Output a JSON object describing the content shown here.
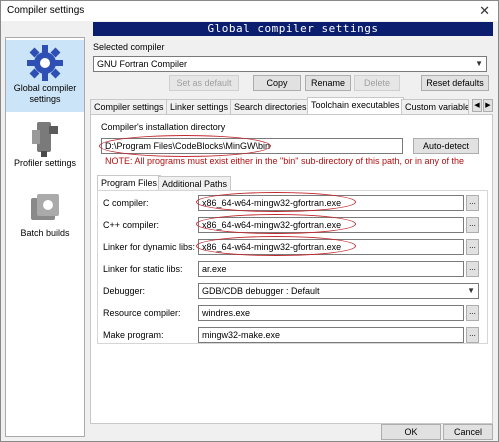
{
  "window": {
    "title": "Compiler settings",
    "close_glyph": "✕",
    "banner": "Global compiler settings"
  },
  "left_panel": {
    "items": [
      {
        "label": "Global compiler settings",
        "icon": "gear-icon"
      },
      {
        "label": "Profiler settings",
        "icon": "profiler-icon"
      },
      {
        "label": "Batch builds",
        "icon": "batch-icon"
      }
    ]
  },
  "compiler": {
    "selected_label": "Selected compiler",
    "selected_value": "GNU Fortran Compiler",
    "buttons": {
      "set_default": "Set as default",
      "copy": "Copy",
      "rename": "Rename",
      "delete": "Delete",
      "reset": "Reset defaults"
    }
  },
  "tabs": [
    "Compiler settings",
    "Linker settings",
    "Search directories",
    "Toolchain executables",
    "Custom variable"
  ],
  "active_tab": "Toolchain executables",
  "install": {
    "label": "Compiler's installation directory",
    "value": "D:\\Program Files\\CodeBlocks\\MinGW\\bin",
    "autodetect": "Auto-detect",
    "note": "NOTE: All programs must exist either in the \"bin\" sub-directory of this path, or in any of the"
  },
  "subtabs": [
    "Program Files",
    "Additional Paths"
  ],
  "programs": [
    {
      "label": "C compiler:",
      "value": "x86_64-w64-mingw32-gfortran.exe"
    },
    {
      "label": "C++ compiler:",
      "value": "x86_64-w64-mingw32-gfortran.exe"
    },
    {
      "label": "Linker for dynamic libs:",
      "value": "x86_64-w64-mingw32-gfortran.exe"
    },
    {
      "label": "Linker for static libs:",
      "value": "ar.exe"
    },
    {
      "label": "Debugger:",
      "value": "GDB/CDB debugger : Default"
    },
    {
      "label": "Resource compiler:",
      "value": "windres.exe"
    },
    {
      "label": "Make program:",
      "value": "mingw32-make.exe"
    }
  ],
  "dots_label": "...",
  "footer": {
    "ok": "OK",
    "cancel": "Cancel"
  },
  "colors": {
    "banner": "#0b1d6e",
    "annotation": "#c0282d",
    "selection": "#cce4f7"
  }
}
